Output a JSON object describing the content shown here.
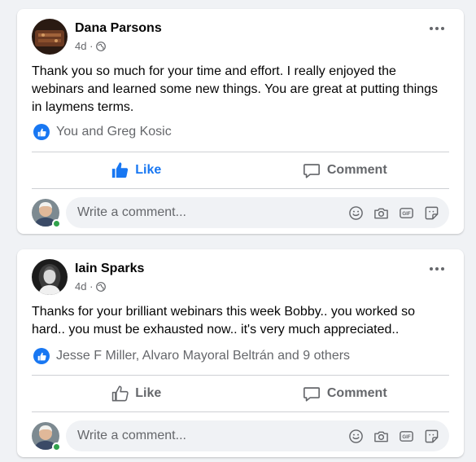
{
  "posts": [
    {
      "author": "Dana Parsons",
      "time": "4d ·",
      "privacy_icon": "globe-icon",
      "text": "Thank you so much for your time and effort. I really enjoyed the webinars and learned some new things. You are great at putting things in laymens terms.",
      "reactions": "You and Greg Kosic",
      "like_label": "Like",
      "liked": true,
      "comment_label": "Comment",
      "comment_placeholder": "Write a comment..."
    },
    {
      "author": "Iain Sparks",
      "time": "4d ·",
      "privacy_icon": "globe-icon",
      "text": "Thanks for your brilliant webinars this week Bobby.. you worked so hard.. you must be exhausted now.. it's very much appreciated..",
      "reactions": "Jesse F Miller, Alvaro Mayoral Beltrán and 9 others",
      "like_label": "Like",
      "liked": false,
      "comment_label": "Comment",
      "comment_placeholder": "Write a comment..."
    }
  ],
  "comment_box_icons": [
    "emoji-icon",
    "camera-icon",
    "gif-icon",
    "sticker-icon"
  ],
  "colors": {
    "accent": "#1877f2",
    "muted": "#65676b",
    "background": "#f0f2f5",
    "online": "#31a24c"
  }
}
